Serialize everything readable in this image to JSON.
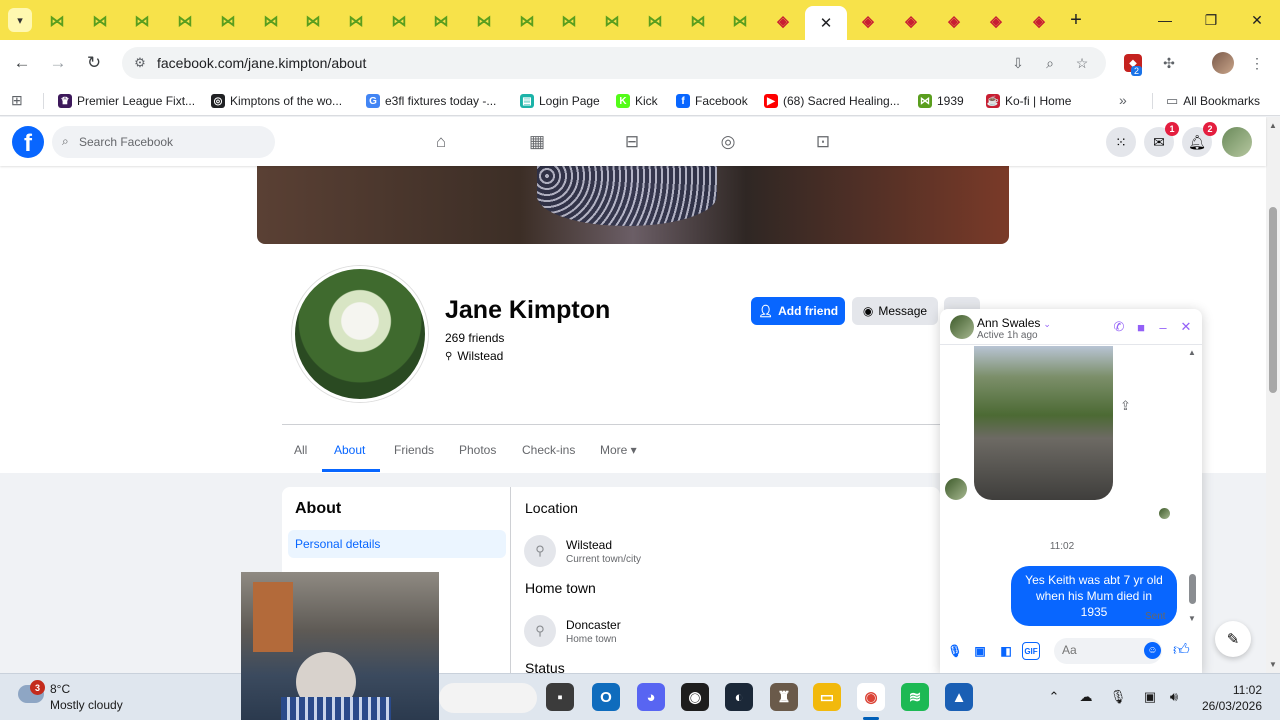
{
  "browser": {
    "address": "facebook.com/jane.kimpton/about",
    "tabs_green_count": 17,
    "tabs_red_before_active": 1,
    "tabs_red_after_active": 5,
    "bookmarks": [
      {
        "label": "Premier League Fixt...",
        "color": "#3d195b",
        "glyph": "♛"
      },
      {
        "label": "Kimptons of the wo...",
        "color": "#202124",
        "glyph": "◎"
      },
      {
        "label": "e3fl fixtures today -...",
        "color": "#4285f4",
        "glyph": "G"
      },
      {
        "label": "Login Page",
        "color": "#1bb3a8",
        "glyph": "▤"
      },
      {
        "label": "Kick",
        "color": "#53fc18",
        "glyph": "K"
      },
      {
        "label": "Facebook",
        "color": "#0866ff",
        "glyph": "f"
      },
      {
        "label": "(68) Sacred Healing...",
        "color": "#ff0000",
        "glyph": "▶"
      },
      {
        "label": "1939",
        "color": "#5a9e1e",
        "glyph": "⋈"
      },
      {
        "label": "Ko-fi | Home",
        "color": "#c81e32",
        "glyph": "☕"
      }
    ],
    "all_bookmarks": "All Bookmarks",
    "ext_badge": "2"
  },
  "fb": {
    "search_placeholder": "Search Facebook",
    "messenger_badge": "1",
    "notif_badge": "2"
  },
  "profile": {
    "name": "Jane Kimpton",
    "friends": "269 friends",
    "location": "Wilstead",
    "add_friend": "Add friend",
    "message": "Message",
    "tabs": [
      "All",
      "About",
      "Friends",
      "Photos",
      "Check-ins",
      "More"
    ],
    "active_tab": "About"
  },
  "about": {
    "title": "About",
    "selected": "Personal details",
    "location_heading": "Location",
    "location_value": "Wilstead",
    "location_label": "Current town/city",
    "hometown_heading": "Home town",
    "hometown_value": "Doncaster",
    "hometown_label": "Home town",
    "status_heading": "Status"
  },
  "chat": {
    "name": "Ann Swales",
    "status": "Active 1h ago",
    "time": "11:02",
    "message": "Yes Keith was abt 7 yr old when his Mum died in 1935",
    "sent": "Sent",
    "input_placeholder": "Aa",
    "accent": "#9360f7"
  },
  "taskbar": {
    "notif_count": "3",
    "temp": "8°C",
    "weather": "Mostly cloudy",
    "time": "11:02",
    "date": "26/03/2026"
  }
}
